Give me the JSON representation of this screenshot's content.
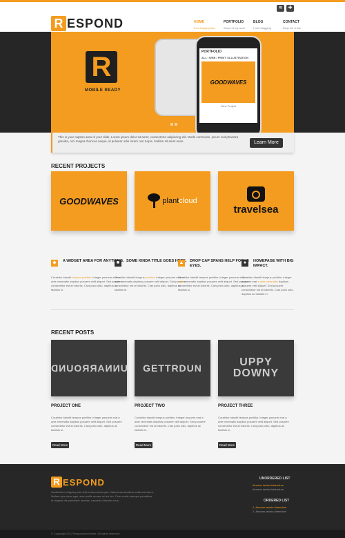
{
  "brand": {
    "logo_letter": "R",
    "logo_text": "ESPOND",
    "accent": "#f39c1f",
    "dark": "#262626"
  },
  "top_icons": [
    "rss-icon",
    "share-icon"
  ],
  "nav": [
    {
      "label": "HOME",
      "sub": "front happy place"
    },
    {
      "label": "PORTFOLIO",
      "sub": "Some of my work"
    },
    {
      "label": "BLOG",
      "sub": "I love blogging"
    },
    {
      "label": "CONTACT",
      "sub": "Drop me a line"
    }
  ],
  "slider": {
    "badge_letter": "R",
    "badge_text": "MOBILE READY",
    "phone_title": "PORTFOLIO",
    "phone_filter": "ALL / WEB / PRINT / ILLUSTRATION",
    "phone_thumb_text": "GOODWAVES",
    "phone_more": "View Project",
    "dots": 3,
    "active_dot": 0
  },
  "caption": {
    "text": "This is your caption area of your slide. Lorem ipsum dolor sit amet, consectetur adipiscing elit. Morbi commodo, ipsum sed pharetra gravida, orci magna rhoncus neque, id pulvinar odio lorem non turpis. Nullam sit amet enim.",
    "button": "Learn More"
  },
  "recent_projects": {
    "title": "RECENT PROJECTS",
    "items": [
      {
        "name": "GOODWAVES"
      },
      {
        "name_a": "plant",
        "name_b": "cloud"
      },
      {
        "name": "travelsea"
      }
    ]
  },
  "widgets": [
    {
      "icon": "◆",
      "title": "A WIDGET AREA FOR ANYTHING.",
      "text_a": "Curabitur blandit ",
      "hl": "tempus porttitor",
      "text_b": ". Integer posuere erat a ante venenatis dapibus posuere velit aliquet. Sed posuere consectetur est at lobortis. Cras justo odio, dapibus ac facilisis in."
    },
    {
      "icon": "■",
      "title": "SOME KINDA TITLE GOES HERE.",
      "text_a": "Curabitur blandit tempus ",
      "hl": "porttitor",
      "text_b": ". Integer posuere erat a ante venenatis dapibus posuere velit aliquet. Sed posuere consectetur est at lobortis. Cras justo odio, dapibus ac facilisis in."
    },
    {
      "icon": "▲",
      "title": "DROP CAP SPANS HELP FOCUS EYES.",
      "text_a": "Curabitur blandit tempus porttitor. Integer posuere erat ",
      "hl": "a ante",
      "text_b": " venenatis dapibus posuere velit aliquet. Sed posuere consectetur est at lobortis. Cras justo odio, dapibus ac facilisis in."
    },
    {
      "icon": "●",
      "title": "HOMEPAGE WITH BIG IMPACT.",
      "text_a": "Curabitur blandit tempus porttitor. Integer posuere erat ",
      "hl": "a ante venenatis",
      "text_b": " dapibus posuere velit aliquet. Sed posuere consectetur est at lobortis. Cras justo odio, dapibus ac facilisis in."
    }
  ],
  "recent_posts": {
    "title": "RECENT POSTS",
    "items": [
      {
        "img_text": "UNNARROUND",
        "title": "PROJECT ONE"
      },
      {
        "img_text": "GETTRDUN",
        "title": "PROJECT TWO"
      },
      {
        "img_text_a": "UPPY",
        "img_text_b": "DOWNY",
        "title": "PROJECT THREE"
      }
    ],
    "text": "Curabitur blandit tempus porttitor. Integer posuere erat a ante venenatis dapibus posuere velit aliquet. Sed posuere consectetur est at lobortis. Cras justo odio, dapibus ac facilisis in.",
    "button": "Read More"
  },
  "footer": {
    "logo_letter": "R",
    "logo_text": "ESPOND",
    "text": "Vestibulum id ligula porta felis euismod semper. Maecenas faucibus mollis interdum. Nullam quis risus eget urna mollis ornare vel eu leo. Cum sociis natoque penatibus et magnis dis parturient montes, nascetur ridiculus mus.",
    "unordered_title": "UNORDERED LIST",
    "unordered": [
      "Aenean lacinia bibendum",
      "Aenean lacinia bibendum"
    ],
    "ordered_title": "ORDERED LIST",
    "ordered": [
      "1. Aenean lacinia bibendum",
      "2. Aenean lacinia bibendum"
    ],
    "copyright": "© Copyright 2012 Responsive theme. All rights reserved."
  }
}
